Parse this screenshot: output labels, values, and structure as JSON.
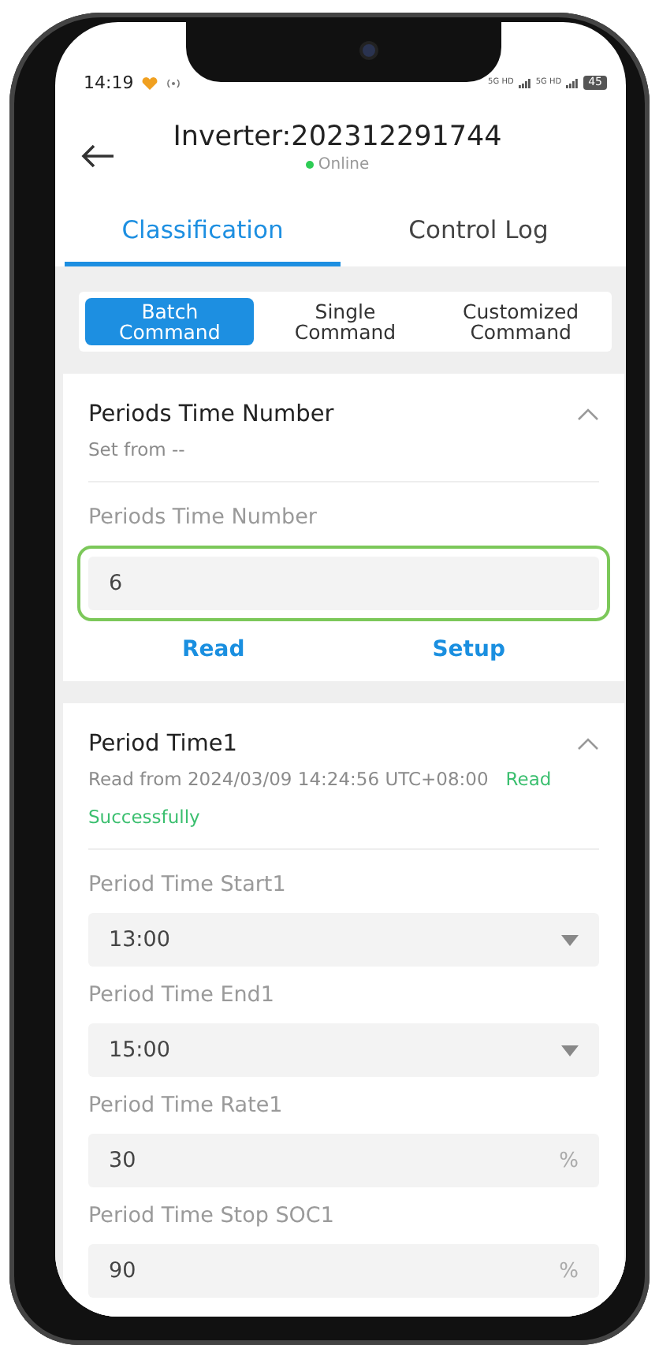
{
  "status_bar": {
    "time": "14:19",
    "network_labels": [
      "5G HD",
      "5G HD"
    ],
    "battery": "45"
  },
  "header": {
    "title": "Inverter:202312291744",
    "status": "Online",
    "online": true
  },
  "tabs": [
    {
      "label": "Classification",
      "selected": true
    },
    {
      "label": "Control Log",
      "selected": false
    }
  ],
  "command_types": [
    {
      "label": "Batch Command",
      "selected": true
    },
    {
      "label": "Single Command",
      "selected": false
    },
    {
      "label": "Customized Command",
      "selected": false
    }
  ],
  "cards": [
    {
      "title": "Periods Time Number",
      "expanded": true,
      "subtitle": "Set from --",
      "fields": [
        {
          "kind": "input",
          "label": "Periods Time Number",
          "value": "6",
          "highlighted": true
        }
      ],
      "actions": [
        "Read",
        "Setup"
      ]
    },
    {
      "title": "Period Time1",
      "expanded": true,
      "subtitle": "Read from 2024/03/09 14:24:56 UTC+08:00",
      "result": "Read Successfully",
      "fields": [
        {
          "kind": "select",
          "label": "Period Time Start1",
          "value": "13:00"
        },
        {
          "kind": "select",
          "label": "Period Time End1",
          "value": "15:00"
        },
        {
          "kind": "input",
          "label": "Period Time Rate1",
          "value": "30",
          "unit": "%"
        },
        {
          "kind": "input",
          "label": "Period Time Stop SOC1",
          "value": "90",
          "unit": "%"
        }
      ]
    }
  ]
}
